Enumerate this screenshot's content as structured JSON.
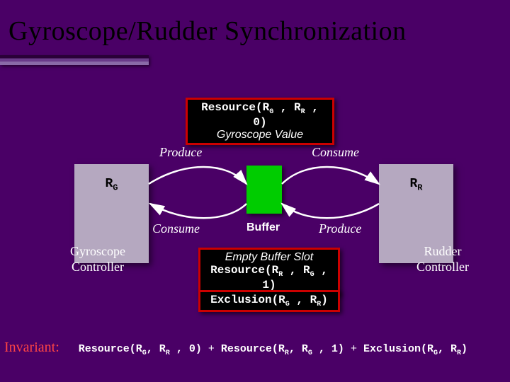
{
  "title": "Gyroscope/Rudder Synchronization",
  "top_box": {
    "resource_text": "Resource(R",
    "resource_sub1": "G",
    "resource_mid": " , R",
    "resource_sub2": "R",
    "resource_end": " , 0)",
    "subtitle": "Gyroscope Value"
  },
  "labels": {
    "produce": "Produce",
    "consume": "Consume",
    "buffer": "Buffer"
  },
  "left_ctrl": {
    "sym": "R",
    "sub": "G",
    "caption": "Gyroscope Controller"
  },
  "right_ctrl": {
    "sym": "R",
    "sub": "R",
    "caption": "Rudder Controller"
  },
  "mid_box": {
    "subtitle": "Empty Buffer Slot",
    "resource_text": "Resource(R",
    "resource_sub1": "R",
    "resource_mid": " , R",
    "resource_sub2": "G",
    "resource_end": " , 1)"
  },
  "excl_box": {
    "text": "Exclusion(R",
    "sub1": "G",
    "mid": " , R",
    "sub2": "R",
    "end": ")"
  },
  "invariant": {
    "label": "Invariant:",
    "r1a": "Resource(R",
    "r1s1": "G",
    "r1m": ", R",
    "r1s2": "R",
    "r1e": " , 0)",
    "plus1": " + ",
    "r2a": "Resource(R",
    "r2s1": "R",
    "r2m": ", R",
    "r2s2": "G",
    "r2e": " , 1)",
    "plus2": " + ",
    "r3a": "Exclusion(R",
    "r3s1": "G",
    "r3m": ", R",
    "r3s2": "R",
    "r3e": ")"
  }
}
